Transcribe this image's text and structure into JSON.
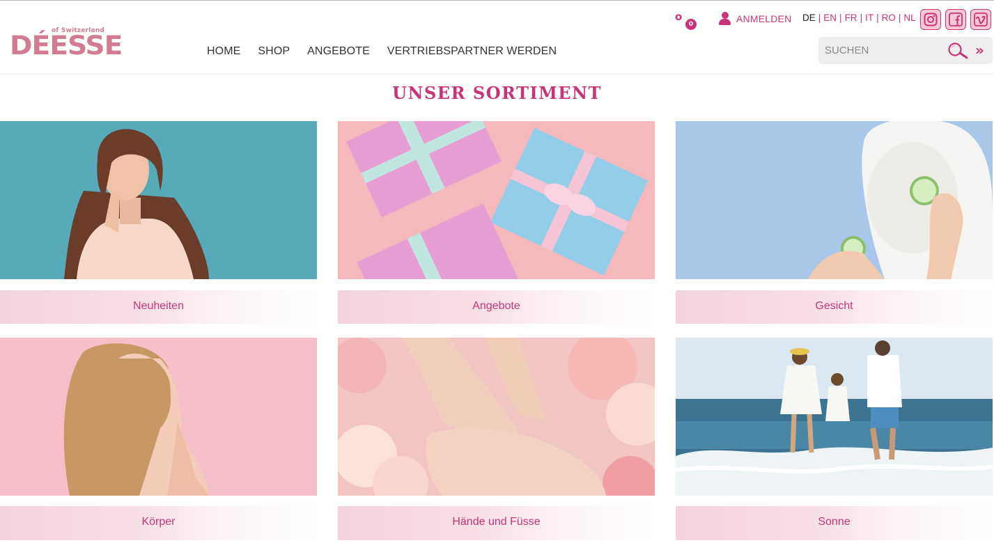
{
  "brand": {
    "name": "DÉESSE",
    "tagline": "of Switzerland"
  },
  "nav": [
    "HOME",
    "SHOP",
    "ANGEBOTE",
    "VERTRIEBSPARTNER WERDEN"
  ],
  "cart": {
    "icon": "o",
    "count": "0"
  },
  "login": {
    "label": "ANMELDEN"
  },
  "languages": [
    "DE",
    "EN",
    "FR",
    "IT",
    "RO",
    "NL"
  ],
  "active_language": "DE",
  "social": [
    "instagram-icon",
    "facebook-icon",
    "vimeo-icon"
  ],
  "search": {
    "placeholder": "SUCHEN",
    "go": "»"
  },
  "section_title": "UNSER SORTIMENT",
  "categories": [
    {
      "label": "Neuheiten"
    },
    {
      "label": "Angebote"
    },
    {
      "label": "Gesicht"
    },
    {
      "label": "Körper"
    },
    {
      "label": "Hände und Füsse"
    },
    {
      "label": "Sonne"
    }
  ],
  "colors": {
    "accent": "#c8347a",
    "logo": "#d17c92",
    "tile_label_bg": "#f4d3dc"
  }
}
